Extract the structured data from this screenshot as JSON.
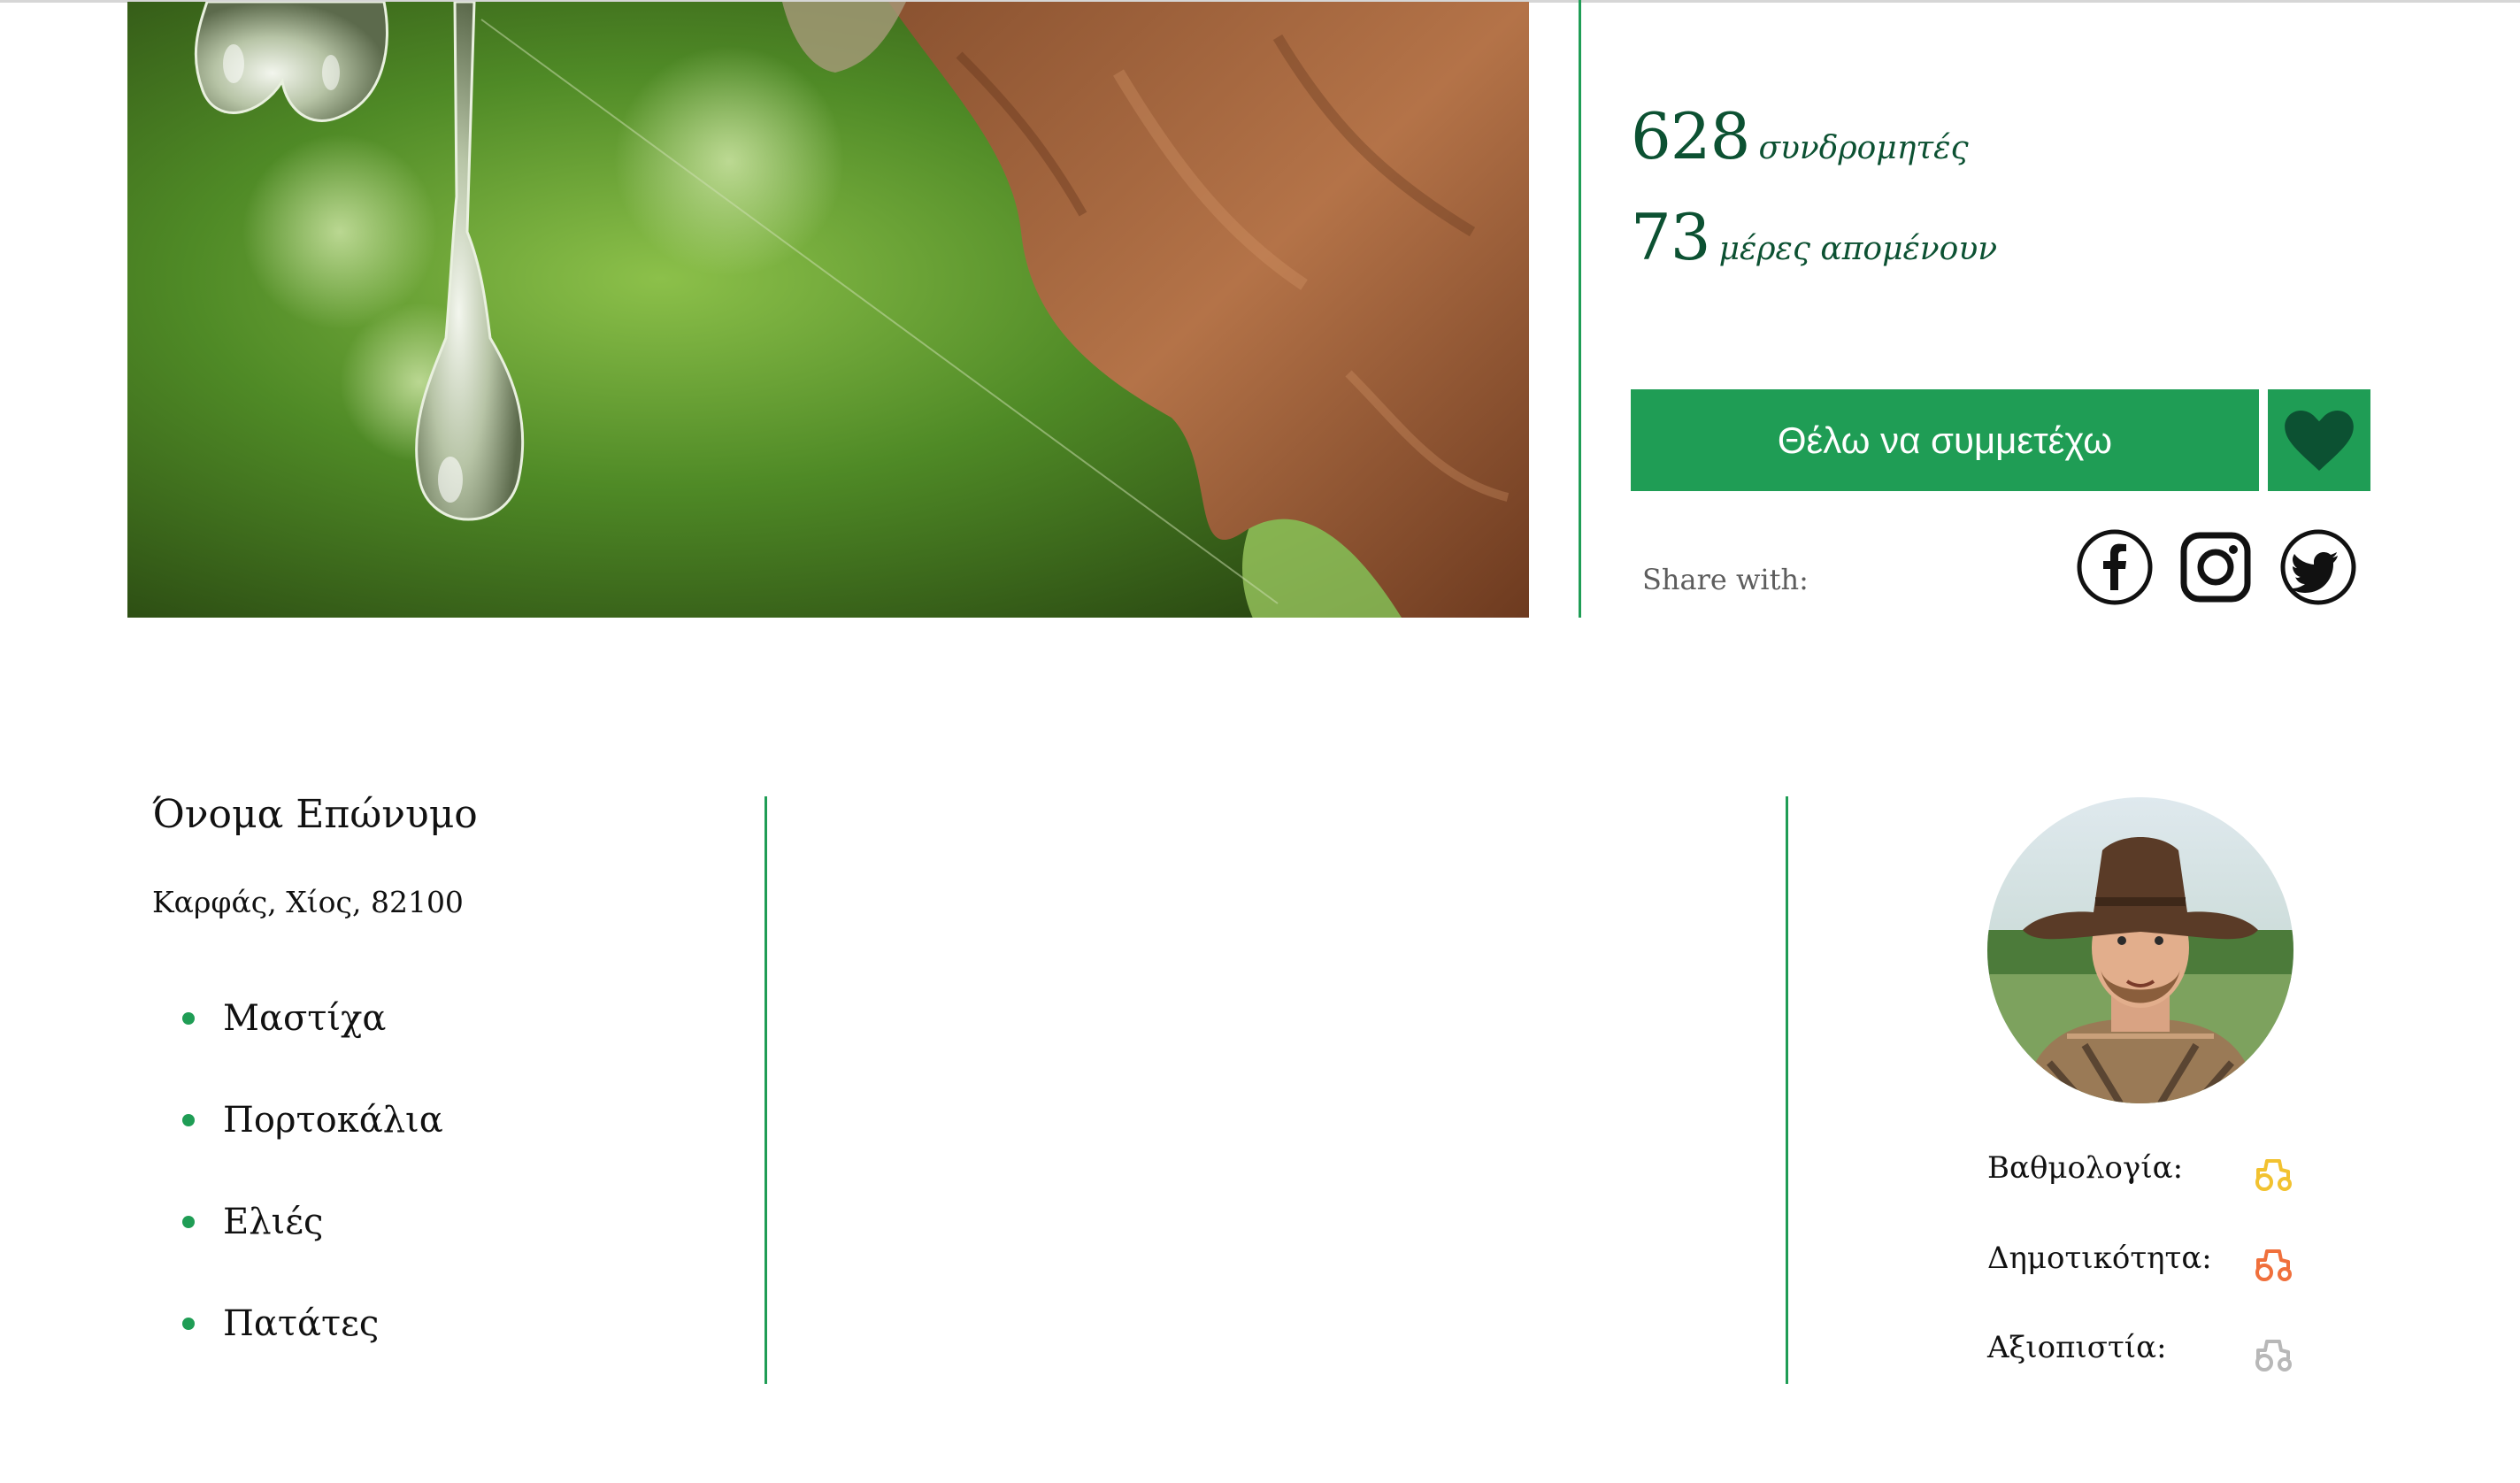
{
  "stats": {
    "subscribers_count": "628",
    "subscribers_label": "συνδρομητές",
    "days_count": "73",
    "days_label": "μέρες απομένουν"
  },
  "cta": {
    "join_label": "Θέλω να συμμετέχω"
  },
  "share": {
    "label": "Share with:",
    "icons": [
      "facebook-icon",
      "instagram-icon",
      "twitter-icon"
    ]
  },
  "profile": {
    "name": "Όνομα Επώνυμο",
    "location": "Καρφάς, Χίος, 82100",
    "products": [
      "Μαστίχα",
      "Πορτοκάλια",
      "Ελιές",
      "Πατάτες"
    ]
  },
  "ratings": [
    {
      "label": "Βαθμολογία:",
      "icon": "tractor-icon",
      "color": "#f2c230"
    },
    {
      "label": "Δημοτικότητα:",
      "icon": "tractor-icon",
      "color": "#f0703c"
    },
    {
      "label": "Αξιοπιστία:",
      "icon": "tractor-icon",
      "color": "#b8b8b8"
    }
  ],
  "colors": {
    "accent": "#1f9d55",
    "dark_green": "#0c5132"
  }
}
